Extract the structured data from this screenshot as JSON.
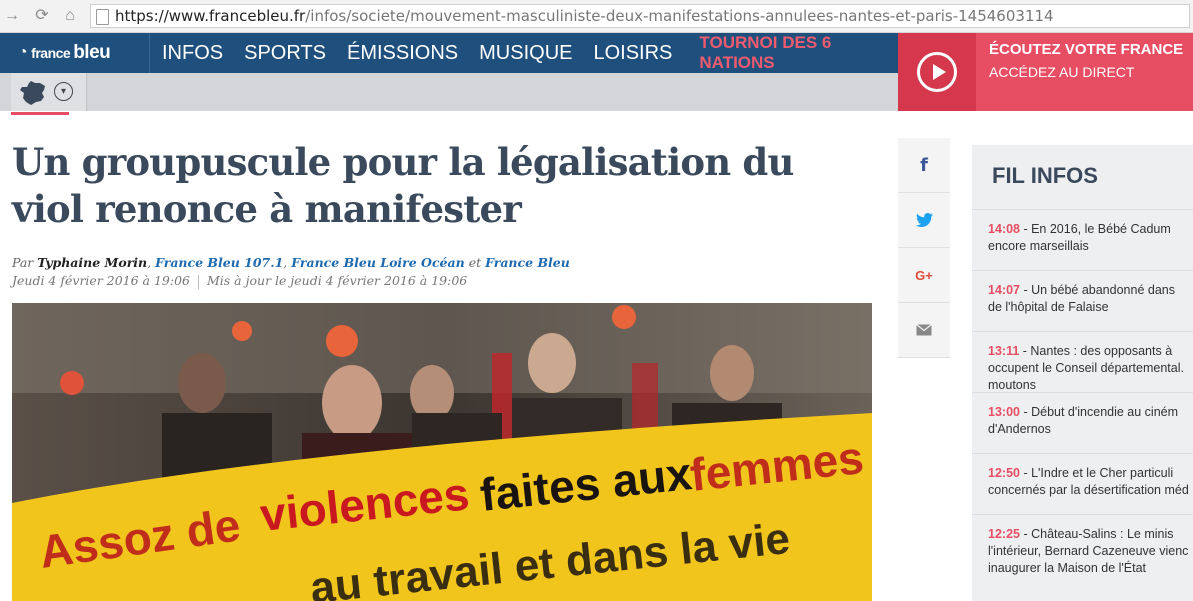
{
  "browser": {
    "url_domain": "https://www.francebleu.fr",
    "url_path": "/infos/societe/mouvement-masculiniste-deux-manifestations-annulees-nantes-et-paris-1454603114"
  },
  "site": {
    "logo_france": "france",
    "logo_bleu": "bleu",
    "menu": [
      "INFOS",
      "SPORTS",
      "ÉMISSIONS",
      "MUSIQUE",
      "LOISIRS"
    ],
    "menu_accent": "TOURNOI DES 6 NATIONS",
    "listen_line1": "ÉCOUTEZ VOTRE FRANCE",
    "listen_line2": "ACCÉDEZ AU DIRECT",
    "accent_color": "#e84e63",
    "brand_color": "#1f4f7c"
  },
  "article": {
    "title": "Un groupuscule pour la légalisation du viol renonce à manifester",
    "by_prefix": "Par",
    "author": "Typhaine Morin",
    "source1": "France Bleu 107.1",
    "source2": "France Bleu Loire Océan",
    "and_word": "et",
    "source3": "France Bleu",
    "published": "Jeudi 4 février 2016 à 19:06",
    "updated": "Mis à jour le jeudi 4 février 2016 à 19:06",
    "banner_line1": "Assoz de violences faites aux femmes",
    "banner_line2": "au travail et dans la vie"
  },
  "share": {
    "facebook_glyph": "f",
    "google_glyph": "G+"
  },
  "fil_infos": {
    "title": "FIL INFOS",
    "items": [
      {
        "time": "14:08",
        "line1": " -  En 2016, le Bébé Cadum",
        "line2": "encore marseillais"
      },
      {
        "time": "14:07",
        "line1": " -  Un bébé abandonné dans",
        "line2": "de l'hôpital de Falaise"
      },
      {
        "time": "13:11",
        "line1": " -  Nantes : des opposants à",
        "line2": "occupent le Conseil départemental.",
        "line3": "moutons"
      },
      {
        "time": "13:00",
        "line1": " -  Début d'incendie au ciném",
        "line2": "d'Andernos"
      },
      {
        "time": "12:50",
        "line1": " -  L'Indre et le Cher particuli",
        "line2": "concernés par la désertification méd"
      },
      {
        "time": "12:25",
        "line1": " -  Château-Salins : Le minis",
        "line2": "l'intérieur, Bernard Cazeneuve vienc",
        "line3": "inaugurer la Maison de l'État"
      }
    ]
  }
}
